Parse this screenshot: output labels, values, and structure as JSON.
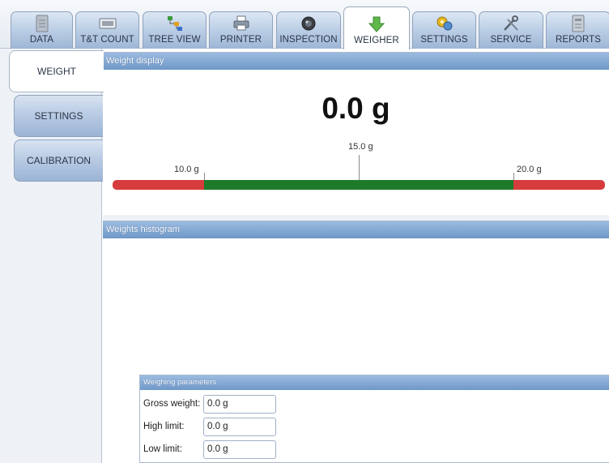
{
  "top_tabs": [
    {
      "label": "DATA",
      "icon": "document-icon"
    },
    {
      "label": "T&T COUNT",
      "icon": "counter-icon"
    },
    {
      "label": "TREE VIEW",
      "icon": "tree-icon"
    },
    {
      "label": "PRINTER",
      "icon": "printer-icon"
    },
    {
      "label": "INSPECTION",
      "icon": "camera-lens-icon"
    },
    {
      "label": "WEIGHER",
      "icon": "down-arrow-icon",
      "active": true
    },
    {
      "label": "SETTINGS",
      "icon": "gears-icon"
    },
    {
      "label": "SERVICE",
      "icon": "tools-icon"
    },
    {
      "label": "REPORTS",
      "icon": "report-icon"
    }
  ],
  "side_tabs": [
    {
      "label": "WEIGHT",
      "active": true
    },
    {
      "label": "SETTINGS"
    },
    {
      "label": "CALIBRATION"
    }
  ],
  "weight_display": {
    "title": "Weight display",
    "value": "0.0 g",
    "scale": {
      "low_label": "10.0 g",
      "mid_label": "15.0 g",
      "high_label": "20.0 g"
    },
    "colors": {
      "out_of_range": "#d63c3c",
      "in_range": "#1d7a2a"
    }
  },
  "histogram": {
    "title": "Weights histogram"
  },
  "weighing_parameters": {
    "title": "Weighing parameters",
    "rows": [
      {
        "label": "Gross weight:",
        "value": "0.0 g"
      },
      {
        "label": "High limit:",
        "value": "0.0 g"
      },
      {
        "label": "Low limit:",
        "value": "0.0 g"
      }
    ]
  }
}
